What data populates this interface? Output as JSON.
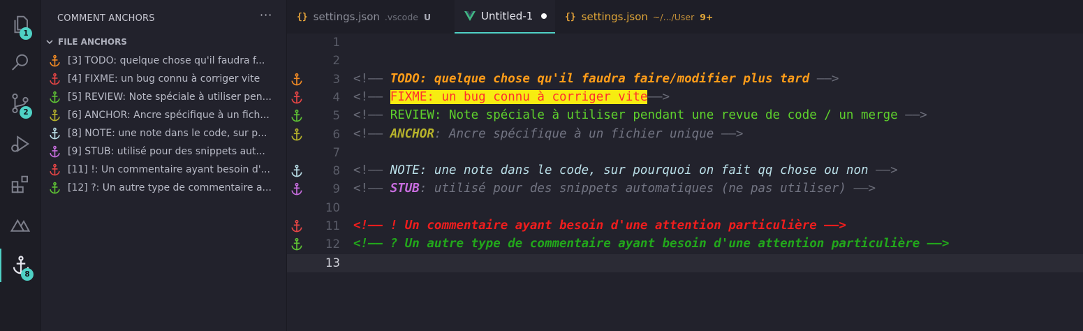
{
  "activity_bar": {
    "explorer_badge": "1",
    "scm_badge": "2",
    "anchors_badge": "8"
  },
  "sidebar": {
    "title": "COMMENT ANCHORS",
    "more": "···",
    "section": "FILE ANCHORS",
    "items": [
      {
        "text": "[3] TODO: quelque chose qu'il faudra f...",
        "color": "#f08a24"
      },
      {
        "text": "[4] FIXME: un bug connu à corriger vite",
        "color": "#e64545"
      },
      {
        "text": "[5] REVIEW: Note spéciale à utiliser pen...",
        "color": "#5ec234"
      },
      {
        "text": "[6] ANCHOR: Ancre spécifique à un fich...",
        "color": "#b7b32b"
      },
      {
        "text": "[8] NOTE: une note dans le code, sur p...",
        "color": "#b9dde6"
      },
      {
        "text": "[9] STUB: utilisé pour des snippets aut...",
        "color": "#c76dde"
      },
      {
        "text": "[11] !: Un commentaire ayant besoin d'...",
        "color": "#e64545"
      },
      {
        "text": "[12] ?: Un autre type de commentaire a...",
        "color": "#5ec234"
      }
    ]
  },
  "tabs": [
    {
      "icon": "{}",
      "name": "settings.json",
      "desc": ".vscode",
      "badge": "U"
    },
    {
      "name": "Untitled-1"
    },
    {
      "icon": "{}",
      "name": "settings.json",
      "desc": "~/.../User",
      "badge": "9+"
    }
  ],
  "editor": {
    "line_numbers": [
      "1",
      "2",
      "3",
      "4",
      "5",
      "6",
      "7",
      "8",
      "9",
      "10",
      "11",
      "12",
      "13"
    ],
    "lines": {
      "l3": {
        "open": "<!—— ",
        "body": "TODO: quelque chose qu'il faudra faire/modifier plus tard",
        "close": " ——>"
      },
      "l4": {
        "open": "<!—— ",
        "body": "FIXME: un bug connu à corriger vite",
        "close": "——>"
      },
      "l5": {
        "open": "<!—— ",
        "body": "REVIEW: Note spéciale à utiliser pendant une revue de code / un merge",
        "close": " ——>"
      },
      "l6": {
        "open": "<!—— ",
        "kw": "ANCHOR",
        "body": ": Ancre spécifique à un fichier unique",
        "close": " ——>"
      },
      "l8": {
        "open": "<!—— ",
        "body": "NOTE: une note dans le code, sur pourquoi on fait qq chose ou non",
        "close": " ——>"
      },
      "l9": {
        "open": "<!—— ",
        "kw": "STUB",
        "body": ": utilisé pour des snippets automatiques (ne pas utiliser)",
        "close": " ——>"
      },
      "l11": {
        "open": "<!—— ",
        "body": "! Un commentaire ayant besoin d'une attention particulière",
        "close": " ——>"
      },
      "l12": {
        "open": "<!—— ",
        "body": "? Un autre type de commentaire ayant besoin d'une attention particulière",
        "close": " ——>"
      }
    },
    "gutter_colors": {
      "l3": "#f08a24",
      "l4": "#e64545",
      "l5": "#5ec234",
      "l6": "#b7b32b",
      "l8": "#b9dde6",
      "l9": "#c76dde",
      "l11": "#e64545",
      "l12": "#5ec234"
    }
  }
}
